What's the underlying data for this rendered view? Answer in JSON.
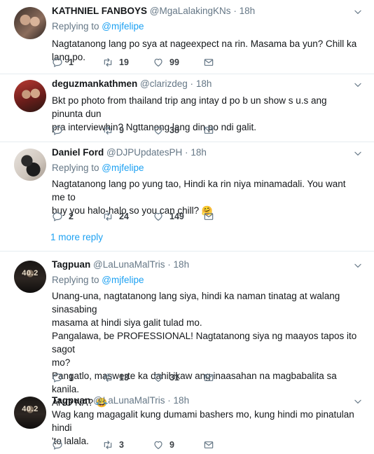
{
  "tweets": [
    {
      "name": "KATHNIEL FANBOYS",
      "handle": "@MgaLalakingKNs",
      "dot": "·",
      "time": "18h",
      "replying_prefix": "Replying to ",
      "replying_to": "@mjfelipe",
      "text": "Nagtatanong lang po sya at nageexpect na rin. Masama ba yun? Chill ka lang po.",
      "replies": "1",
      "retweets": "19",
      "likes": "99"
    },
    {
      "name": "deguzmankathmen",
      "handle": "@clarizdeg",
      "dot": "·",
      "time": "18h",
      "text": "Bkt po photo from thailand trip ang intay d po b un show s u.s ang pinunta dun\npra interviewhin? Ngttanong lang din po ndi galit.",
      "replies": "",
      "retweets": "9",
      "likes": "38"
    },
    {
      "name": "Daniel Ford",
      "handle": "@DJPUpdatesPH",
      "dot": "·",
      "time": "18h",
      "replying_prefix": "Replying to ",
      "replying_to": "@mjfelipe",
      "text": "Nagtatanong lang po yung tao, Hindi ka rin niya minamadali. You want me to\nbuy you halo-halo so you can chill? ",
      "emoji": "🤗",
      "replies": "2",
      "retweets": "24",
      "likes": "149",
      "more_replies": "1 more reply"
    },
    {
      "name": "Tagpuan",
      "handle": "@LaLunaMalTris",
      "dot": "·",
      "time": "18h",
      "avatar_text": "40.2",
      "replying_prefix": "Replying to ",
      "replying_to": "@mjfelipe",
      "text": "Unang-una, nagtatanong lang siya, hindi ka naman tinatag at walang sinasabing\nmasama at hindi siya galit tulad mo.\nPangalawa, be PROFESSIONAL! Nagtatanong siya ng maayos tapos ito sagot\nmo?\nPangatlo, maswerte ka dahil ikaw ang inaasahan na magbabalita sa kanila.\nANO NA? ",
      "emoji": "😂",
      "replies": "1",
      "retweets": "13",
      "likes": "31"
    },
    {
      "name": "Tagpuan",
      "handle": "@LaLunaMalTris",
      "dot": "·",
      "time": "18h",
      "avatar_text": "40.2",
      "text": "Wag kang magagalit kung dumami bashers mo, kung hindi mo pinatulan hindi\n'to lalala.",
      "replies": "",
      "retweets": "3",
      "likes": "9"
    }
  ],
  "icons": {
    "reply": "reply-icon",
    "retweet": "retweet-icon",
    "like": "heart-icon",
    "message": "envelope-icon",
    "more": "chevron-down-icon"
  },
  "colors": {
    "link": "#1da1f2",
    "muted": "#657786",
    "text": "#14171a",
    "divider": "#e6ecf0"
  }
}
